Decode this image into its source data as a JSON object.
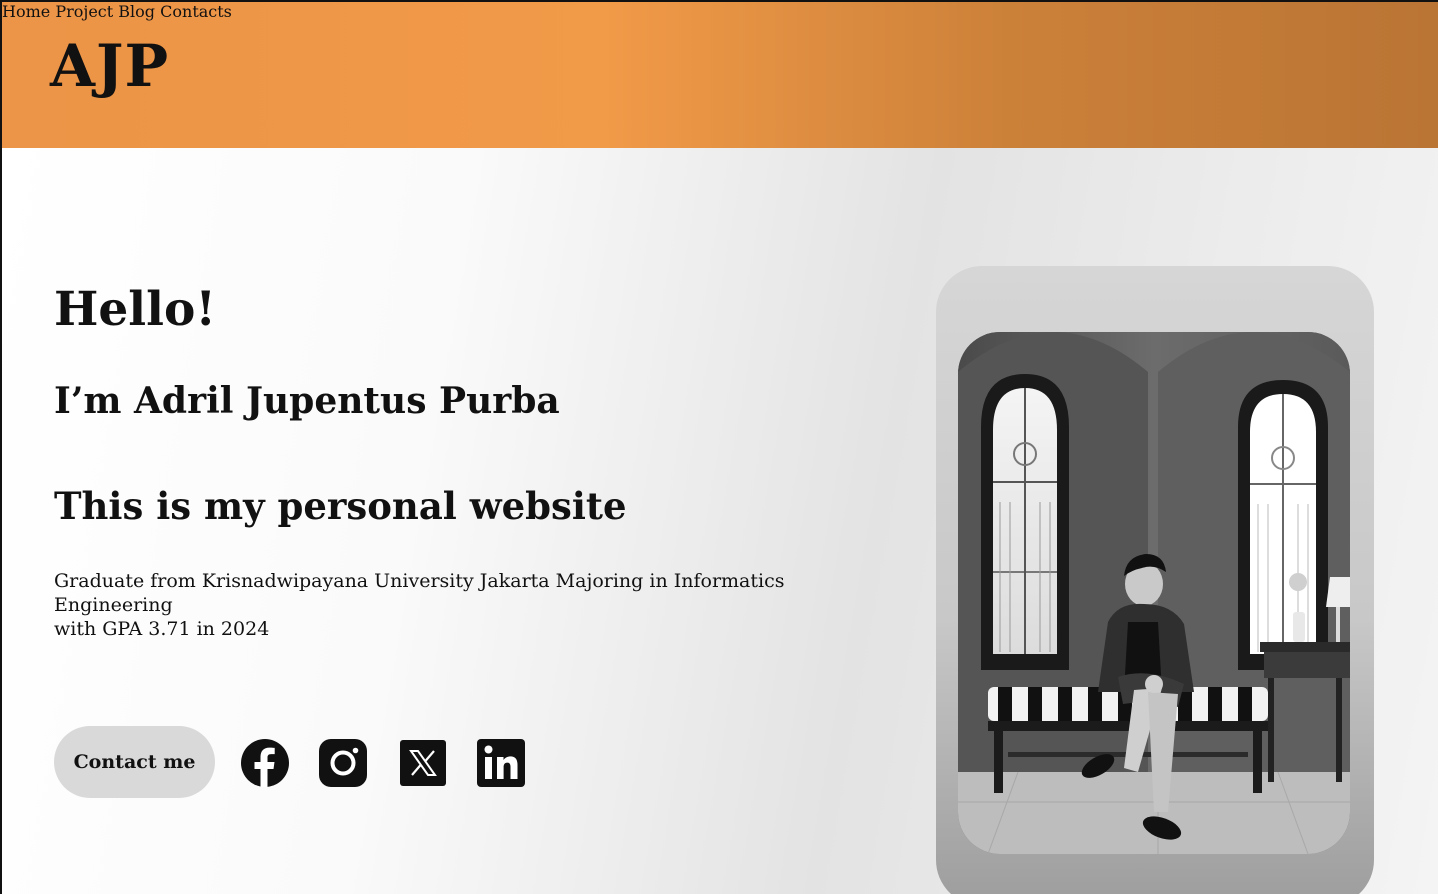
{
  "header": {
    "logo": "AJP",
    "nav": [
      {
        "label": "Home",
        "active": true
      },
      {
        "label": "Project",
        "active": false
      },
      {
        "label": "Blog",
        "active": false
      },
      {
        "label": "Contacts",
        "active": false
      }
    ],
    "gradient_colors": [
      "#ec9447",
      "#ba7434"
    ],
    "active_nav_color": "#ffffff"
  },
  "hero": {
    "greeting": "Hello!",
    "name": "I’m Adril Jupentus Purba",
    "tagline": "This is my personal website",
    "bio_line1": "Graduate from Krisnadwipayana University Jakarta Majoring in Informatics Engineering",
    "bio_line2": "with GPA 3.71 in 2024",
    "contact_button": "Contact me",
    "social_icons": [
      "facebook-icon",
      "instagram-icon",
      "x-twitter-icon",
      "linkedin-icon"
    ]
  },
  "photo": {
    "style": "black-and-white",
    "icon": "profile-photo"
  }
}
